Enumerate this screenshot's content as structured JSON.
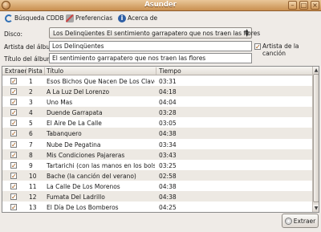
{
  "window": {
    "title": "Asunder"
  },
  "toolbar": {
    "cddb": "Búsqueda CDDB",
    "prefs": "Preferencias",
    "about": "Acerca de"
  },
  "form": {
    "disc_label": "Disco:",
    "disc_value": "Los Delinqüentes  El sentimiento garrapatero que nos traen las flores",
    "artist_label": "Artista del álbum:",
    "artist_value": "Los Delinqüentes",
    "title_label": "Título del álbum:",
    "title_value": "El sentimiento garrapatero que nos traen las flores",
    "track_artist_label": "Artista de la canción"
  },
  "table": {
    "headers": [
      "Extraer",
      "Pista",
      "Título",
      "Tiempo"
    ],
    "tracks": [
      {
        "n": "1",
        "title": "Esos Bichos Que Nacen De Los Claveles",
        "time": "03:31"
      },
      {
        "n": "2",
        "title": "A La Luz Del Lorenzo",
        "time": "04:18"
      },
      {
        "n": "3",
        "title": "Uno Mas",
        "time": "04:04"
      },
      {
        "n": "4",
        "title": "Duende Garrapata",
        "time": "03:28"
      },
      {
        "n": "5",
        "title": "El Aire De La Calle",
        "time": "03:05"
      },
      {
        "n": "6",
        "title": "Tabanquero",
        "time": "04:38"
      },
      {
        "n": "7",
        "title": "Nube De Pegatina",
        "time": "03:34"
      },
      {
        "n": "8",
        "title": "Mis Condiciones Pajareras",
        "time": "03:43"
      },
      {
        "n": "9",
        "title": "Tartarichi (con las manos en los bolsillos)",
        "time": "03:25"
      },
      {
        "n": "10",
        "title": "Bache (la canción del verano)",
        "time": "02:58"
      },
      {
        "n": "11",
        "title": "La Calle De Los Morenos",
        "time": "04:38"
      },
      {
        "n": "12",
        "title": "Fumata Del Ladrillo",
        "time": "04:38"
      },
      {
        "n": "13",
        "title": "El Día De Los Bomberos",
        "time": "04:25"
      }
    ]
  },
  "actions": {
    "rip": "Extraer"
  }
}
